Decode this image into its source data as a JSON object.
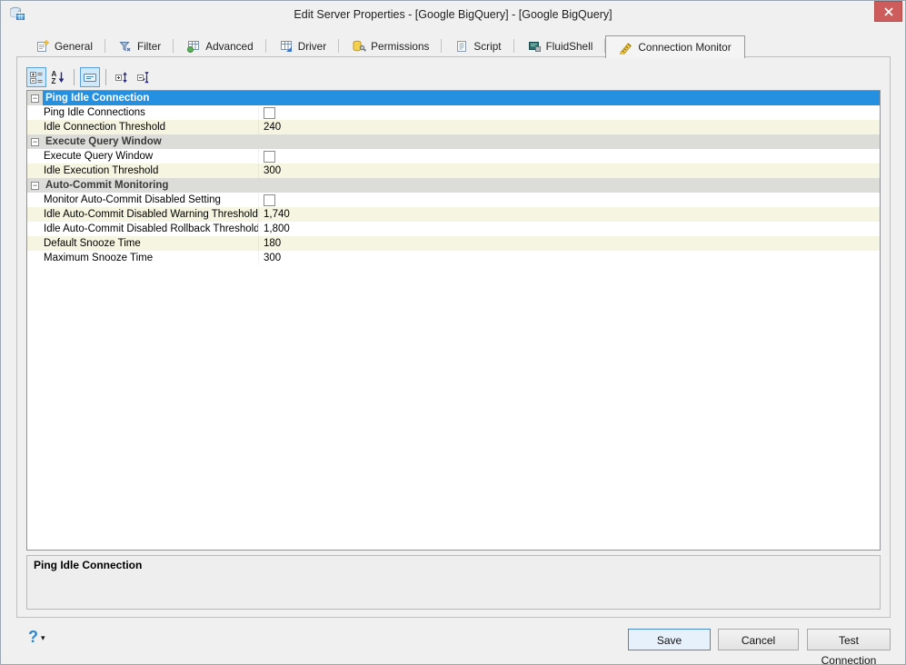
{
  "window": {
    "title": "Edit Server Properties - [Google BigQuery] - [Google BigQuery]"
  },
  "tabs": [
    {
      "label": "General",
      "icon": "form-star-icon",
      "active": false
    },
    {
      "label": "Filter",
      "icon": "filter-funnel-icon",
      "active": false
    },
    {
      "label": "Advanced",
      "icon": "grid-green-ball-icon",
      "active": false
    },
    {
      "label": "Driver",
      "icon": "grid-blue-arrow-icon",
      "active": false
    },
    {
      "label": "Permissions",
      "icon": "yellow-db-key-icon",
      "active": false
    },
    {
      "label": "Script",
      "icon": "script-page-icon",
      "active": false
    },
    {
      "label": "FluidShell",
      "icon": "terminal-icon",
      "active": false
    },
    {
      "label": "Connection Monitor",
      "icon": "monitor-pencil-icon",
      "active": true
    }
  ],
  "toolbar": {
    "buttons": [
      {
        "name": "categorized-view",
        "pressed": true
      },
      {
        "name": "alphabetical-sort",
        "pressed": false
      },
      {
        "name": "show-description-panel",
        "pressed": true
      },
      {
        "name": "expand-all",
        "pressed": false
      },
      {
        "name": "collapse-all",
        "pressed": false
      }
    ]
  },
  "property_grid": {
    "sections": [
      {
        "title": "Ping Idle Connection",
        "selected": true,
        "rows": [
          {
            "name": "Ping Idle Connections",
            "type": "checkbox",
            "checked": false
          },
          {
            "name": "Idle Connection Threshold",
            "type": "text",
            "value": "240"
          }
        ]
      },
      {
        "title": "Execute Query Window",
        "selected": false,
        "rows": [
          {
            "name": "Execute Query Window",
            "type": "checkbox",
            "checked": false
          },
          {
            "name": "Idle Execution Threshold",
            "type": "text",
            "value": "300"
          }
        ]
      },
      {
        "title": "Auto-Commit Monitoring",
        "selected": false,
        "rows": [
          {
            "name": "Monitor Auto-Commit Disabled Setting",
            "type": "checkbox",
            "checked": false
          },
          {
            "name": "Idle Auto-Commit Disabled Warning Threshold",
            "type": "text",
            "value": "1,740"
          },
          {
            "name": "Idle Auto-Commit Disabled Rollback Threshold",
            "type": "text",
            "value": "1,800"
          },
          {
            "name": "Default Snooze Time",
            "type": "text",
            "value": "180"
          },
          {
            "name": "Maximum Snooze Time",
            "type": "text",
            "value": "300"
          }
        ]
      }
    ]
  },
  "description_panel": {
    "title": "Ping Idle Connection"
  },
  "footer": {
    "help_label": "?",
    "save_label": "Save",
    "cancel_label": "Cancel",
    "test_connection_label": "Test Connection"
  },
  "colors": {
    "selected_category": "#2690e0",
    "category_bg": "#dcdcd8",
    "alt_row_bg": "#f5f5e2",
    "close_button": "#cd5c5c",
    "accent_border": "#5c9fd8"
  }
}
